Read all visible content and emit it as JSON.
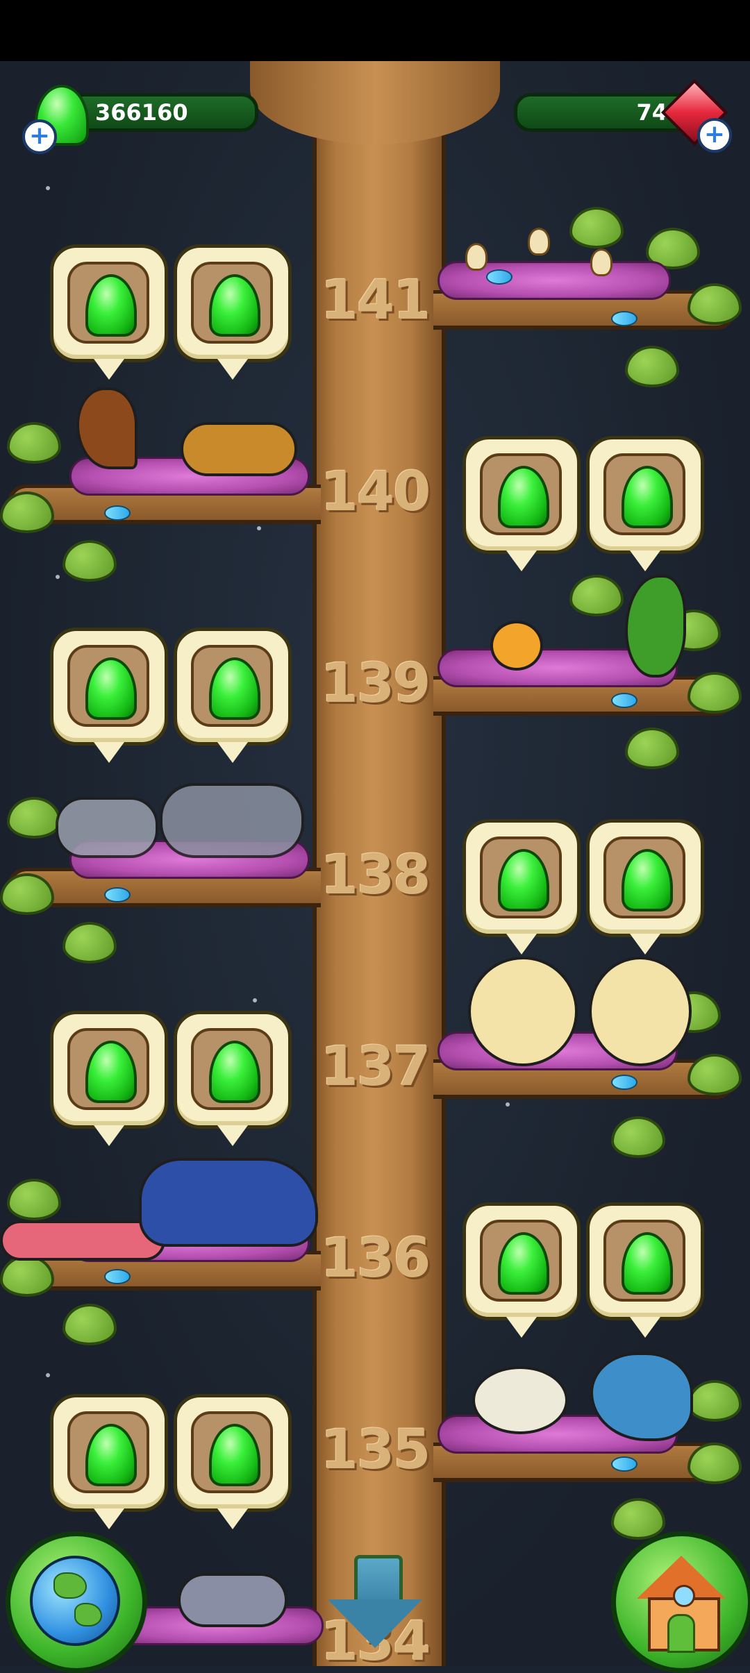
{
  "status_bar": {},
  "hud": {
    "gem_count": "366160",
    "ruby_count": "74",
    "add_gems_label": "+",
    "add_rubies_label": "+"
  },
  "levels": [
    {
      "number": "141",
      "gem_slots_side": "left",
      "slots": 2,
      "creatures_side": "right"
    },
    {
      "number": "140",
      "gem_slots_side": "right",
      "slots": 2,
      "creatures_side": "left"
    },
    {
      "number": "139",
      "gem_slots_side": "left",
      "slots": 2,
      "creatures_side": "right"
    },
    {
      "number": "138",
      "gem_slots_side": "right",
      "slots": 2,
      "creatures_side": "left"
    },
    {
      "number": "137",
      "gem_slots_side": "left",
      "slots": 2,
      "creatures_side": "right"
    },
    {
      "number": "136",
      "gem_slots_side": "right",
      "slots": 2,
      "creatures_side": "left"
    },
    {
      "number": "135",
      "gem_slots_side": "left",
      "slots": 2,
      "creatures_side": "right"
    },
    {
      "number": "134",
      "gem_slots_side": "none",
      "slots": 0,
      "creatures_side": "left"
    }
  ],
  "buttons": {
    "map": "globe-icon",
    "scroll_down": "down-arrow-icon",
    "home": "house-icon"
  },
  "colors": {
    "background": "#1c2330",
    "trunk": "#c89052",
    "gem": "#3cf03c",
    "nest": "#e07ad8",
    "hud_bar": "#1f6b28"
  }
}
